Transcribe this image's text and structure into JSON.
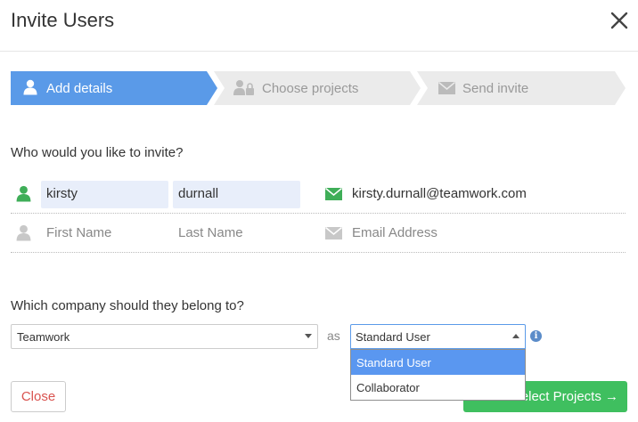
{
  "dialog": {
    "title": "Invite Users"
  },
  "steps": [
    {
      "label": "Add details",
      "state": "active"
    },
    {
      "label": "Choose projects",
      "state": "inactive"
    },
    {
      "label": "Send invite",
      "state": "inactive"
    }
  ],
  "invite": {
    "question": "Who would you like to invite?",
    "rows": [
      {
        "first_name": "kirsty",
        "last_name": "durnall",
        "email": "kirsty.durnall@teamwork.com"
      }
    ],
    "placeholders": {
      "first_name": "First Name",
      "last_name": "Last Name",
      "email": "Email Address"
    }
  },
  "company": {
    "question": "Which company should they belong to?",
    "selected": "Teamwork",
    "as_word": "as",
    "role_selected": "Standard User",
    "role_options": [
      "Standard User",
      "Collaborator"
    ]
  },
  "footer": {
    "close_label": "Close",
    "next_label": "Select Projects →"
  },
  "colors": {
    "active_step": "#5a9ae8",
    "inactive_step": "#ebebeb",
    "green": "#3fbf5f",
    "close_red": "#d9534f"
  }
}
